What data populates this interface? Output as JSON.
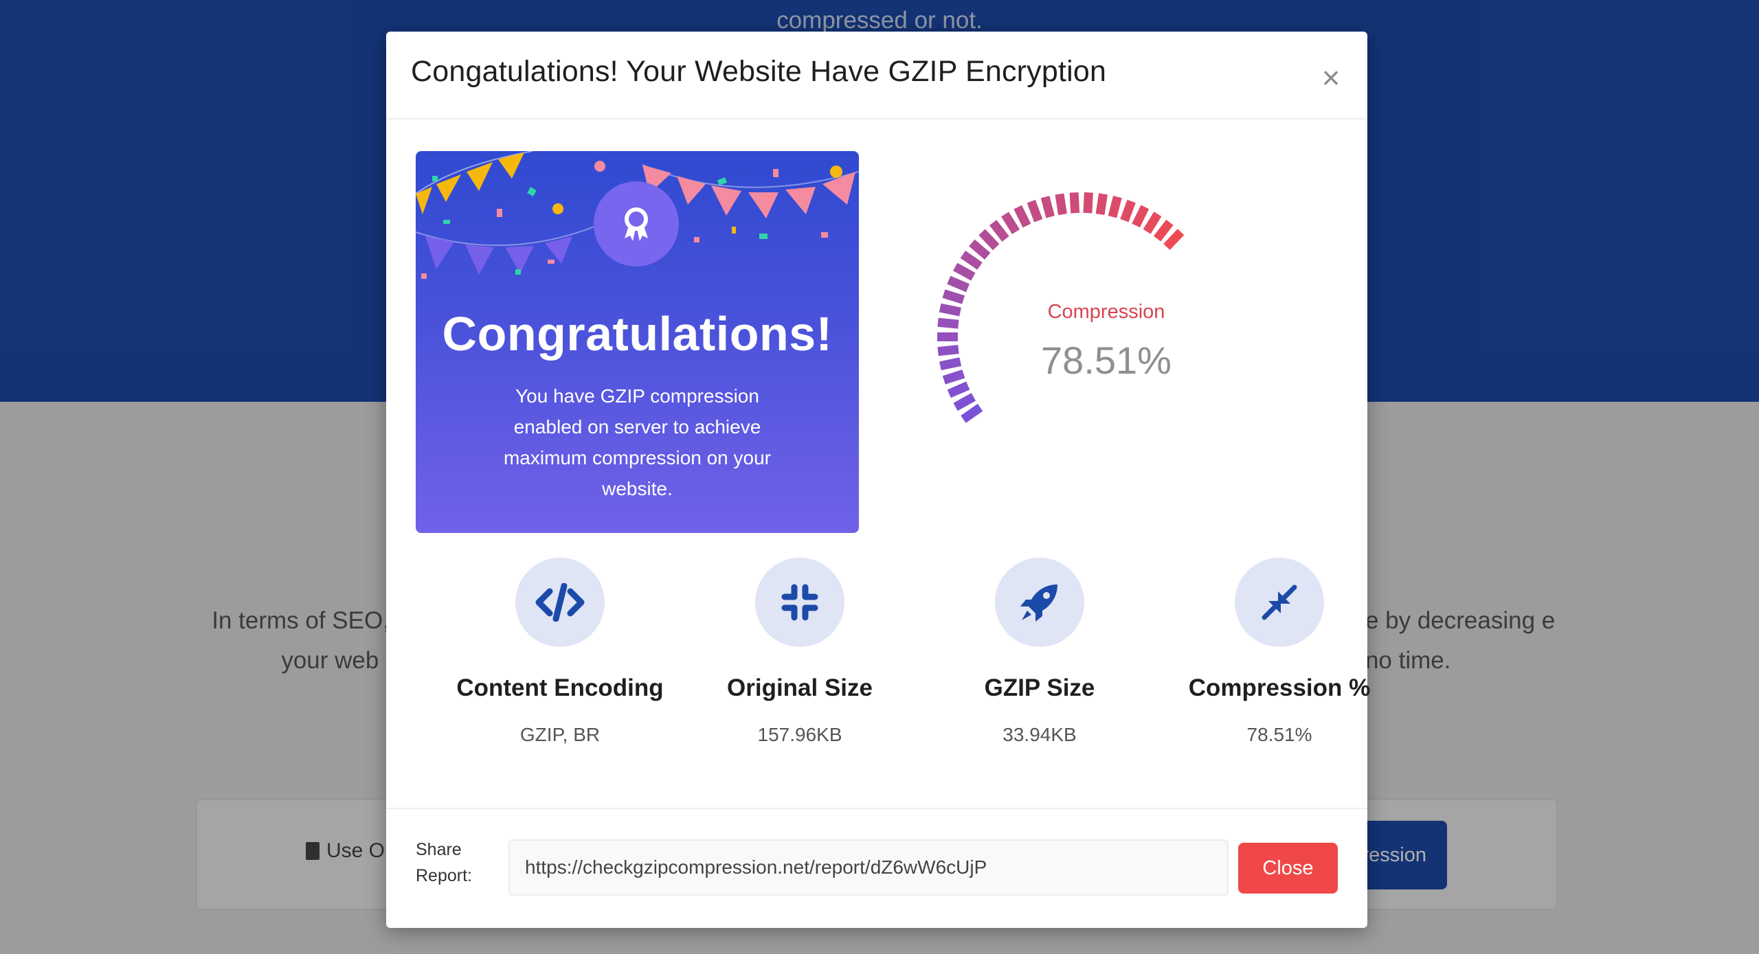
{
  "background": {
    "top_text": "compressed or not.",
    "left_para": "In terms of SEO, S your web pa",
    "right_para": "nce by decreasing e in no time.",
    "use_label": "Use O",
    "button_partial": "ression"
  },
  "modal": {
    "title": "Congatulations! Your Website Have GZIP Encryption",
    "close_x": "×",
    "card": {
      "title": "Congratulations!",
      "text": "You have GZIP compression enabled on server to achieve maximum compression on your website."
    },
    "gauge": {
      "label": "Compression",
      "value_text": "78.51%",
      "fraction": 0.7851
    },
    "stats": [
      {
        "label": "Content Encoding",
        "value": "GZIP, BR",
        "icon": "code-icon"
      },
      {
        "label": "Original Size",
        "value": "157.96KB",
        "icon": "compress-icon"
      },
      {
        "label": "GZIP Size",
        "value": "33.94KB",
        "icon": "rocket-icon"
      },
      {
        "label": "Compression %",
        "value": "78.51%",
        "icon": "arrows-in-icon"
      }
    ],
    "share": {
      "label": "Share Report:",
      "url": "https://checkgzipcompression.net/report/dZ6wW6cUjP"
    },
    "close_button": "Close"
  },
  "colors": {
    "brand_blue": "#1c4aa8",
    "icon_blue": "#1c4aa8",
    "danger": "#f04848",
    "gauge_start": "#7a52d8",
    "gauge_end": "#ee4a52"
  }
}
